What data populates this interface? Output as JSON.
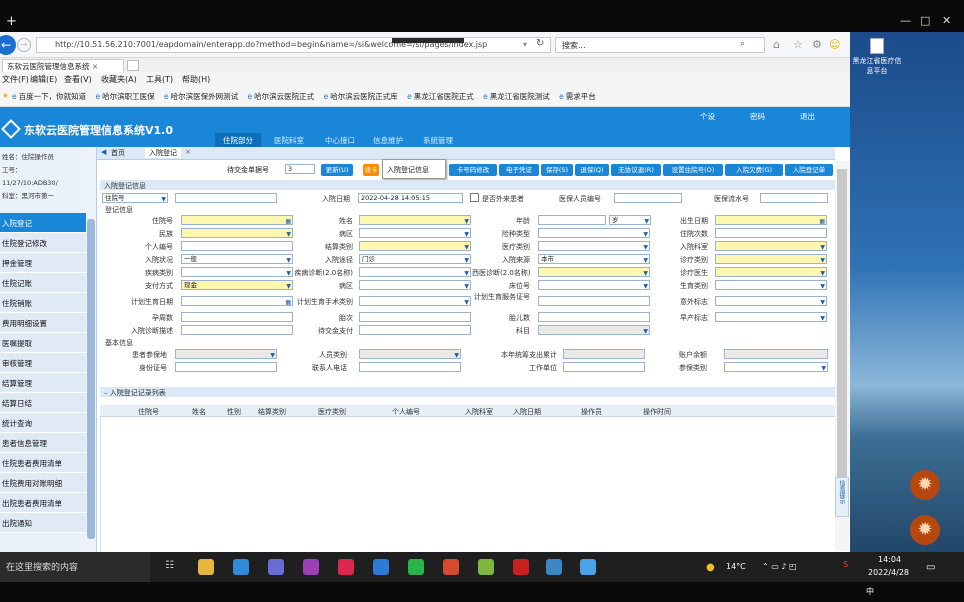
{
  "window": {
    "plus": "+",
    "minimize": "—",
    "maximize": "□",
    "close": "✕"
  },
  "browser": {
    "url": "http://10.51.56.210:7001/eapdomain/enterapp.do?method=begin&name=/si&welcome=/si/pages/index.jsp",
    "search_value": "搜索...",
    "tab_title": "东软云医院管理信息系统",
    "menu": [
      "文件(F)",
      "编辑(E)",
      "查看(V)",
      "收藏夹(A)",
      "工具(T)",
      "帮助(H)"
    ],
    "favorites": [
      "百度一下，你就知道",
      "哈尔滨职工医保",
      "哈尔滨医保外网测试",
      "哈尔滨云医院正式",
      "哈尔滨云医院正式库",
      "黑龙江省医院正式",
      "黑龙江省医院测试",
      "需求平台"
    ]
  },
  "app": {
    "title": "东软云医院管理信息系统V1.0",
    "nav": [
      "住院部分",
      "医院科室",
      "中心接口",
      "信息维护",
      "系统管理"
    ],
    "header_tools": [
      "个设",
      "密码",
      "退出"
    ],
    "user": [
      "姓名：住院操作员",
      "工号：",
      "11/27/10:ADB30/",
      "科室：黑河市第一"
    ],
    "sidebar": [
      "入院登记",
      "住院登记修改",
      "押金管理",
      "住院记账",
      "住院销账",
      "费用明细设置",
      "医嘱提取",
      "审核管理",
      "结算管理",
      "结算日结",
      "统计查询",
      "患者信息管理",
      "住院患者费用清单",
      "住院费用对账明细",
      "出院患者费用清单",
      "出院通知"
    ],
    "breadcrumb": [
      "首页",
      "入院登记"
    ],
    "toolbar": {
      "label": "待交金单据号",
      "value": "3",
      "buttons": [
        "更新(U)",
        "读卡",
        "入院登记信息",
        "卡号码修改",
        "电子凭证",
        "保存(S)",
        "退保(Q)",
        "无协议退(R)",
        "设置住院号(O)",
        "入院欠费(G)",
        "入院登记单"
      ]
    },
    "tooltip": "入院登记信息",
    "section_top": "入院登记信息",
    "query": {
      "type": "住院号",
      "date_label": "入院日期",
      "date_value": "2022-04-28 14:05:15",
      "child_label": "是否外来患者",
      "org_label": "医保人员编号",
      "serial_label": "医保流水号"
    },
    "reg_title": "登记信息",
    "rows": [
      [
        "住院号",
        "",
        "姓名",
        "",
        "年龄",
        "岁",
        "出生日期",
        ""
      ],
      [
        "民族",
        "",
        "病区",
        "",
        "险种类型",
        "",
        "住院次数",
        ""
      ],
      [
        "个人编号",
        "",
        "结算类别",
        "",
        "医疗类别",
        "",
        "入院科室",
        ""
      ],
      [
        "入院状况",
        "一般",
        "入院途径",
        "门诊",
        "入院来源",
        "本市",
        "诊疗类别",
        ""
      ],
      [
        "疾病类别",
        "",
        "疾病诊断(2.0名称)",
        "",
        "西医诊断(2.0名称)",
        "",
        "诊疗医生",
        ""
      ],
      [
        "支付方式",
        "现金",
        "病区",
        "",
        "床位号",
        "",
        "生育类别",
        ""
      ],
      [
        "计划生育日期",
        "",
        "计划生育手术类别",
        "",
        "计划生育服务证号",
        "",
        "意外标志",
        ""
      ],
      [
        "孕周数",
        "",
        "胎次",
        "",
        "胎儿数",
        "",
        "早产标志",
        ""
      ],
      [
        "入院诊断描述",
        "",
        "待交金支付",
        "",
        "科目",
        "",
        ""
      ]
    ],
    "basic_title": "基本信息",
    "basic": [
      [
        "患者参保地",
        "",
        "人员类别",
        "",
        "本年统筹支出累计",
        "",
        "账户余额",
        ""
      ],
      [
        "身份证号",
        "",
        "联系人电话",
        "",
        "工作单位",
        "",
        "参保类别",
        ""
      ]
    ],
    "list_title": "入院登记记录列表",
    "grid_headers": [
      "住院号",
      "姓名",
      "性别",
      "结算类别",
      "医疗类别",
      "个人编号",
      "入院科室",
      "入院日期",
      "操作员",
      "操作时间"
    ],
    "right_tab": "信息提示"
  },
  "desktop": {
    "icon_label": "黑龙江省医疗信息平台"
  },
  "taskbar": {
    "search_placeholder": "在这里搜索的内容",
    "weather": "14°C",
    "time": "14:04",
    "date": "2022/4/28",
    "ime": "中"
  }
}
